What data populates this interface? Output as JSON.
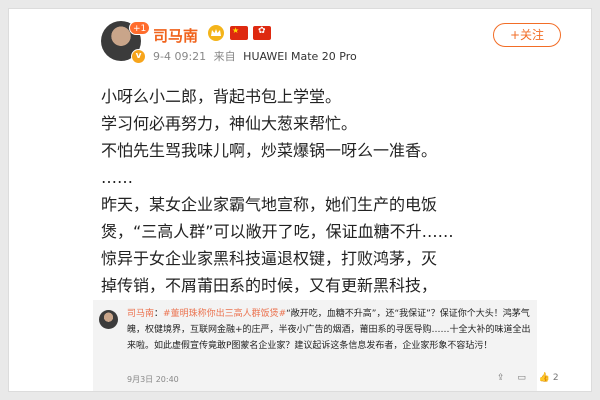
{
  "author": {
    "name": "司马南",
    "avatar_badge": "+1",
    "verified_mark": "v",
    "badges": [
      "crown-icon",
      "china-flag-icon",
      "hongkong-flag-icon"
    ],
    "time": "9-4 09:21",
    "source_prefix": "来自",
    "device": "HUAWEI Mate 20 Pro"
  },
  "follow_label": "+关注",
  "post_lines": [
    "小呀么小二郎，背起书包上学堂。",
    "学习何必再努力，神仙大葱来帮忙。",
    "不怕先生骂我味儿啊，炒菜爆锅一呀么一准香。",
    "……",
    "昨天，某女企业家霸气地宣称，她们生产的电饭",
    "煲，“三高人群”可以敞开了吃，保证血糖不升……",
    "惊异于女企业家黑科技逼退权键，打败鸿茅，灭",
    "掉传销，不屑莆田系的时候，又有更新黑科技，"
  ],
  "quote": {
    "name": "司马南",
    "tag": "#董明珠称你出三高人群饭煲#",
    "text": "“敞开吃，血糖不升高”，还“我保证”？保证你个大头！鸿茅气魄，权健境界，互联网金融+的庄严，半夜小广告的烟酒，莆田系的寻医导购……十全大补的味道全出来啦。如此虚假宣传竟敢P图蒙名企业家？建议起诉这条信息发布者，企业家形象不容玷污！",
    "time": "9月3日 20:40",
    "shares": "",
    "comments": "",
    "likes": "2"
  },
  "colors": {
    "accent": "#f26d26",
    "name": "#f0631c",
    "link": "#eb7350"
  }
}
